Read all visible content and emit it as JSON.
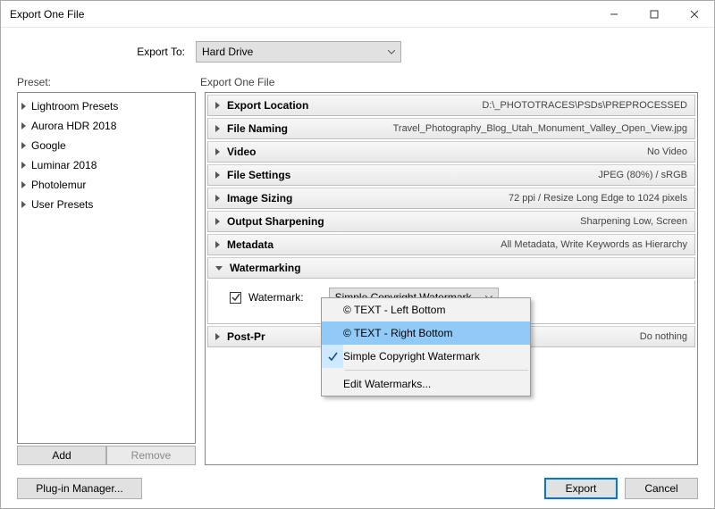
{
  "window": {
    "title": "Export One File"
  },
  "export_to": {
    "label": "Export To:",
    "value": "Hard Drive"
  },
  "preset": {
    "label": "Preset:",
    "items": [
      {
        "label": "Lightroom Presets"
      },
      {
        "label": "Aurora HDR 2018"
      },
      {
        "label": "Google"
      },
      {
        "label": "Luminar 2018"
      },
      {
        "label": "Photolemur"
      },
      {
        "label": "User Presets"
      }
    ],
    "add_label": "Add",
    "remove_label": "Remove"
  },
  "right": {
    "heading": "Export One File",
    "sections": {
      "export_location": {
        "title": "Export Location",
        "value": "D:\\_PHOTOTRACES\\PSDs\\PREPROCESSED"
      },
      "file_naming": {
        "title": "File Naming",
        "value": "Travel_Photography_Blog_Utah_Monument_Valley_Open_View.jpg"
      },
      "video": {
        "title": "Video",
        "value": "No Video"
      },
      "file_settings": {
        "title": "File Settings",
        "value": "JPEG (80%) / sRGB"
      },
      "image_sizing": {
        "title": "Image Sizing",
        "value": "72 ppi / Resize Long Edge to 1024 pixels"
      },
      "output_sharpening": {
        "title": "Output Sharpening",
        "value": "Sharpening Low, Screen"
      },
      "metadata": {
        "title": "Metadata",
        "value": "All Metadata, Write Keywords as Hierarchy"
      },
      "watermarking": {
        "title": "Watermarking",
        "checkbox_label": "Watermark:",
        "selected": "Simple Copyright Watermark"
      },
      "post_processing": {
        "title": "Post-Pr",
        "value": "Do nothing"
      }
    }
  },
  "dropdown": {
    "items": [
      {
        "label": "© TEXT - Left Bottom",
        "checked": false,
        "highlight": false
      },
      {
        "label": "© TEXT - Right Bottom",
        "checked": false,
        "highlight": true
      },
      {
        "label": "Simple Copyright Watermark",
        "checked": true,
        "highlight": false
      }
    ],
    "edit_label": "Edit Watermarks..."
  },
  "footer": {
    "plugin_manager": "Plug-in Manager...",
    "export": "Export",
    "cancel": "Cancel"
  }
}
